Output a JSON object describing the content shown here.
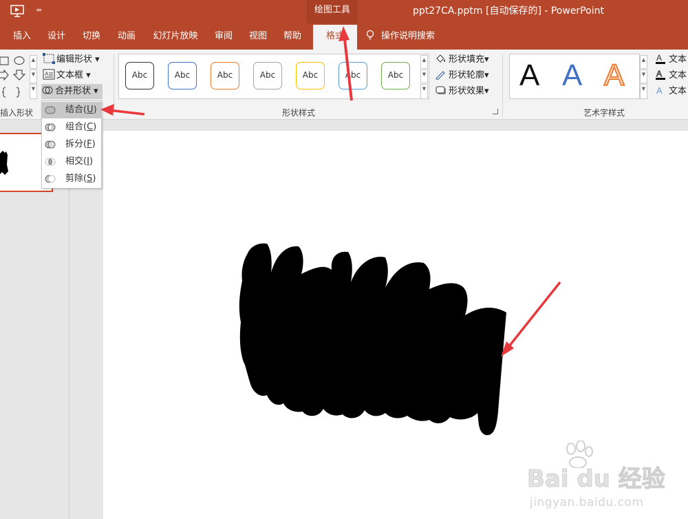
{
  "titlebar": {
    "context_group": "绘图工具",
    "document_title": "ppt27CA.pptm [自动保存的] - PowerPoint"
  },
  "tabs": [
    {
      "label": "插入"
    },
    {
      "label": "设计"
    },
    {
      "label": "切换"
    },
    {
      "label": "动画"
    },
    {
      "label": "幻灯片放映"
    },
    {
      "label": "审阅"
    },
    {
      "label": "视图"
    },
    {
      "label": "帮助"
    },
    {
      "label": "格式"
    }
  ],
  "tell_me": "操作说明搜索",
  "ribbon": {
    "insert_shapes": {
      "label": "插入形状",
      "edit_shape": "编辑形状",
      "text_box": "文本框",
      "merge_shapes": "合并形状"
    },
    "shape_styles": {
      "label": "形状样式",
      "swatch_text": "Abc",
      "swatch_colors": [
        "#333333",
        "#4472c4",
        "#ed7d31",
        "#a5a5a5",
        "#ffc000",
        "#5b9bd5",
        "#70ad47"
      ],
      "fill": "形状填充",
      "outline": "形状轮廓",
      "effects": "形状效果"
    },
    "wordart": {
      "label": "艺术字样式",
      "letter": "A",
      "text_fill": "文本",
      "text_outline": "文本",
      "text_effects": "文本"
    }
  },
  "merge_menu": {
    "items": [
      {
        "label": "结合",
        "key": "U",
        "active": true
      },
      {
        "label": "组合",
        "key": "C",
        "active": false
      },
      {
        "label": "拆分",
        "key": "F",
        "active": false
      },
      {
        "label": "相交",
        "key": "I",
        "active": false
      },
      {
        "label": "剪除",
        "key": "S",
        "active": false
      }
    ]
  },
  "watermark": {
    "brand": "Bai du 经验",
    "url": "jingyan.baidu.com"
  },
  "colors": {
    "accent": "#b7472a",
    "arrow": "#e8393c"
  }
}
